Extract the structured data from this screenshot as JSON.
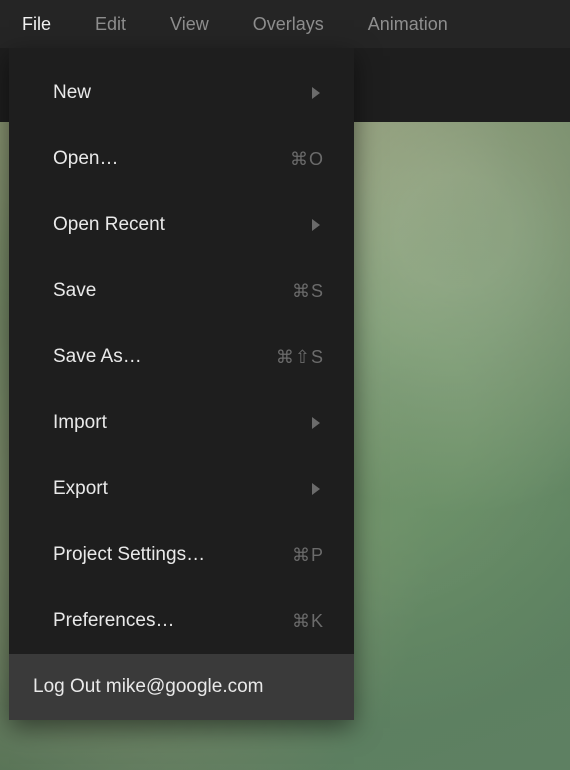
{
  "menubar": {
    "file": "File",
    "edit": "Edit",
    "view": "View",
    "overlays": "Overlays",
    "animation": "Animation"
  },
  "file_menu": {
    "new": "New",
    "open": "Open…",
    "open_shortcut": "⌘O",
    "open_recent": "Open Recent",
    "save": "Save",
    "save_shortcut": "⌘S",
    "save_as": "Save As…",
    "save_as_shortcut": "⌘⇧S",
    "import": "Import",
    "export": "Export",
    "project_settings": "Project Settings…",
    "project_settings_shortcut": "⌘P",
    "preferences": "Preferences…",
    "preferences_shortcut": "⌘K",
    "log_out": "Log Out mike@google.com"
  }
}
